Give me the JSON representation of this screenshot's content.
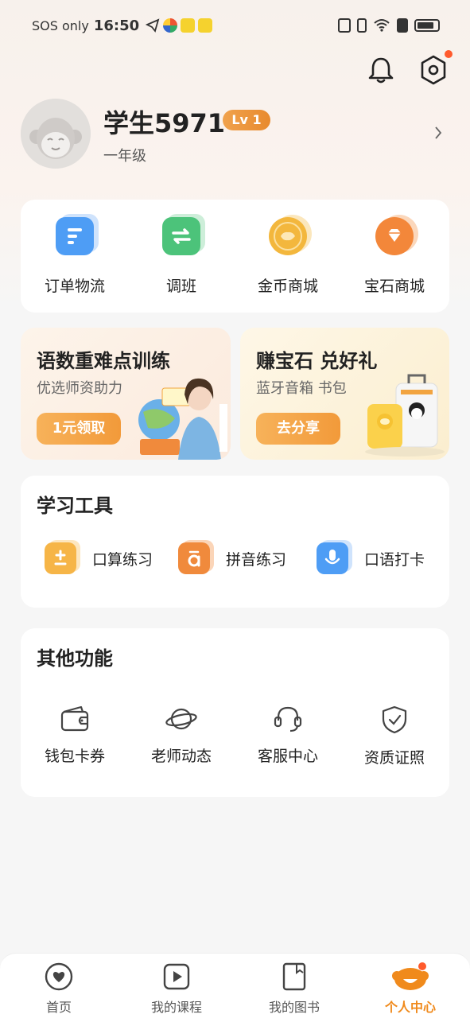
{
  "status_bar": {
    "carrier": "SOS only",
    "time": "16:50"
  },
  "header": {
    "icons": [
      "bell-icon",
      "settings-icon"
    ]
  },
  "profile": {
    "username": "学生5971",
    "level": "Lv 1",
    "grade": "一年级"
  },
  "quick_actions": [
    {
      "label": "订单物流",
      "icon": "order-icon",
      "color": "#4e9df5"
    },
    {
      "label": "调班",
      "icon": "swap-class-icon",
      "color": "#4cc37a"
    },
    {
      "label": "金币商城",
      "icon": "coin-icon",
      "color": "#f3b73d"
    },
    {
      "label": "宝石商城",
      "icon": "gem-icon",
      "color": "#f3873a"
    }
  ],
  "promos": [
    {
      "title": "语数重难点训练",
      "subtitle": "优选师资助力",
      "button": "1元领取"
    },
    {
      "title": "赚宝石 兑好礼",
      "subtitle": "蓝牙音箱 书包",
      "button": "去分享"
    }
  ],
  "tools": {
    "title": "学习工具",
    "items": [
      {
        "label": "口算练习",
        "icon": "arithmetic-icon",
        "color": "#f6b547"
      },
      {
        "label": "拼音练习",
        "icon": "pinyin-icon",
        "color": "#f08a3c"
      },
      {
        "label": "口语打卡",
        "icon": "microphone-icon",
        "color": "#4e9df5"
      }
    ]
  },
  "other": {
    "title": "其他功能",
    "items": [
      {
        "label": "钱包卡券",
        "icon": "wallet-icon"
      },
      {
        "label": "老师动态",
        "icon": "planet-icon"
      },
      {
        "label": "客服中心",
        "icon": "headset-icon"
      },
      {
        "label": "资质证照",
        "icon": "shield-check-icon"
      }
    ]
  },
  "tabbar": {
    "items": [
      {
        "label": "首页",
        "icon": "home-icon"
      },
      {
        "label": "我的课程",
        "icon": "course-icon"
      },
      {
        "label": "我的图书",
        "icon": "book-icon"
      },
      {
        "label": "个人中心",
        "icon": "profile-mascot-icon",
        "active": true
      }
    ]
  },
  "colors": {
    "accent": "#f08a1c",
    "badge_red": "#ff5a2c"
  }
}
